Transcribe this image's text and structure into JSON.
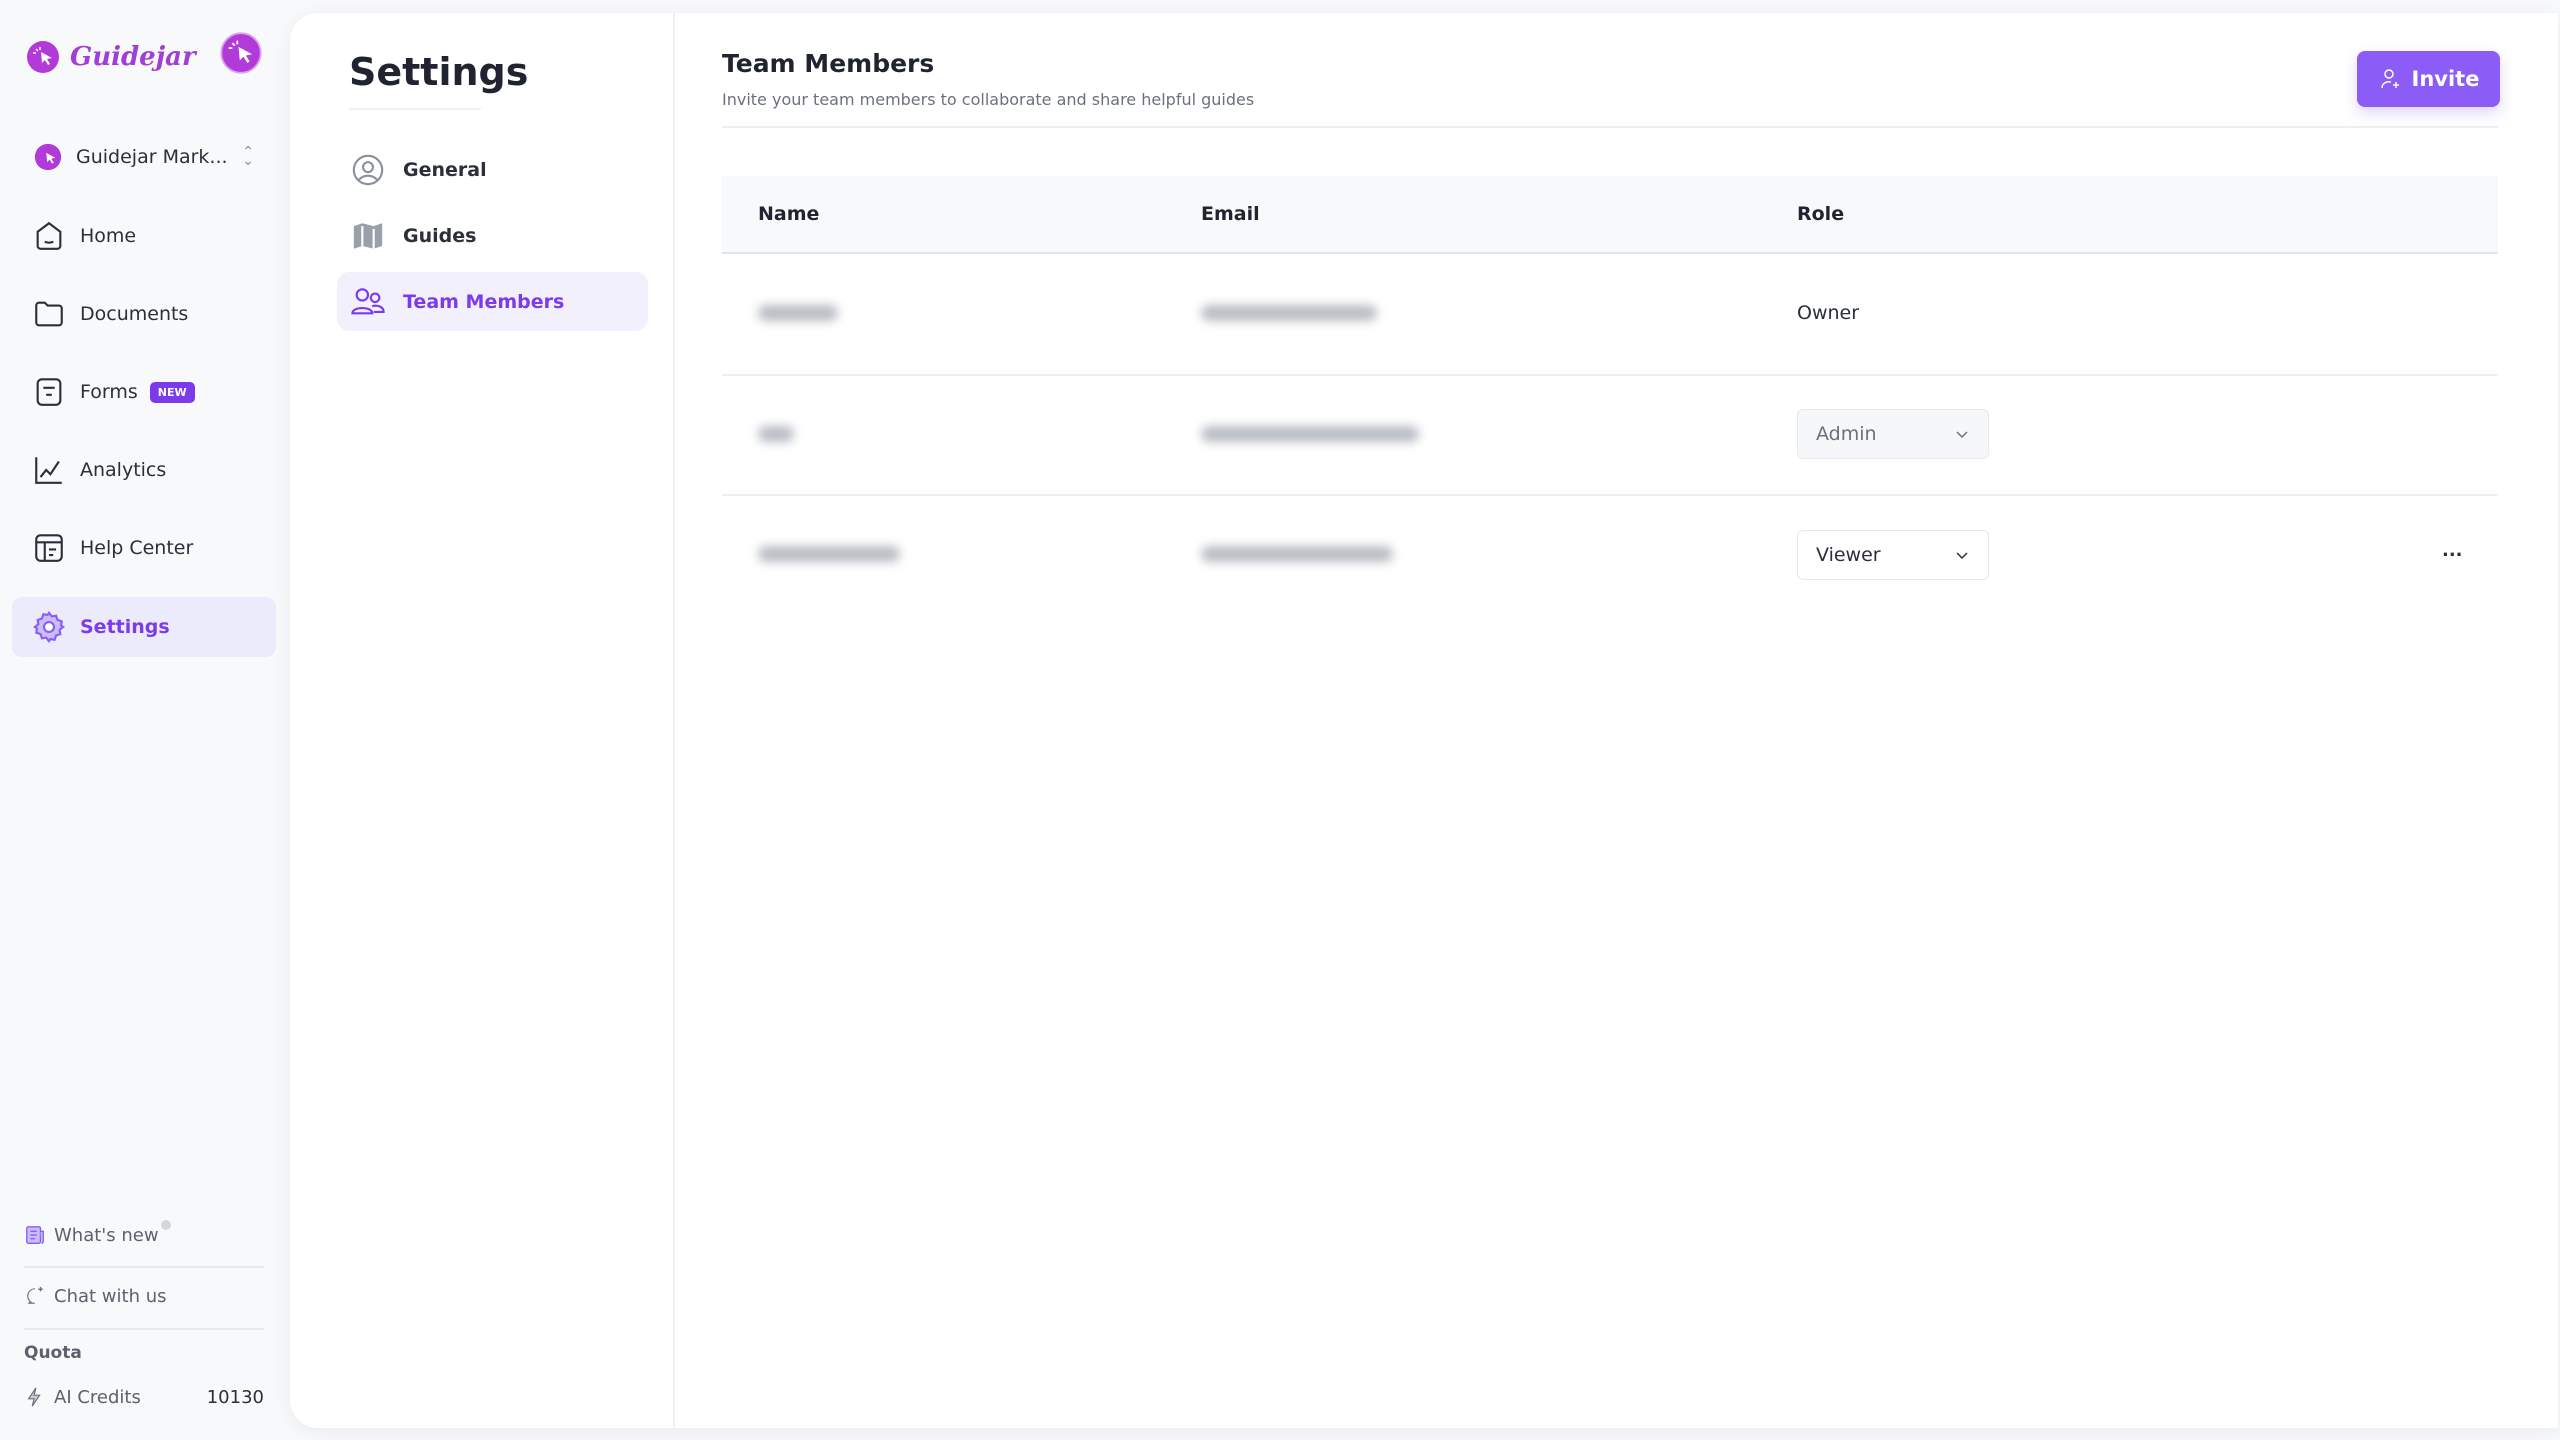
{
  "brand": {
    "name": "Guidejar",
    "accent": "#7c3aed"
  },
  "workspace": {
    "name": "Guidejar Mark..."
  },
  "sidebar": {
    "items": [
      {
        "label": "Home",
        "icon": "home-icon"
      },
      {
        "label": "Documents",
        "icon": "folder-icon"
      },
      {
        "label": "Forms",
        "icon": "form-icon",
        "badge": "NEW"
      },
      {
        "label": "Analytics",
        "icon": "chart-icon"
      },
      {
        "label": "Help Center",
        "icon": "help-center-icon"
      },
      {
        "label": "Settings",
        "icon": "gear-icon",
        "active": true
      }
    ]
  },
  "footer": {
    "whats_new": "What's new",
    "chat": "Chat with us",
    "quota_label": "Quota",
    "credits_label": "AI Credits",
    "credits_value": "10130"
  },
  "settings": {
    "title": "Settings",
    "nav": [
      {
        "label": "General",
        "icon": "user-circle-icon"
      },
      {
        "label": "Guides",
        "icon": "map-icon"
      },
      {
        "label": "Team Members",
        "icon": "users-icon",
        "active": true
      }
    ]
  },
  "team": {
    "title": "Team Members",
    "subtitle": "Invite your team members to collaborate and share helpful guides",
    "invite_label": "Invite",
    "columns": [
      "Name",
      "Email",
      "Role"
    ],
    "rows": [
      {
        "role": "Owner"
      },
      {
        "role": "Admin",
        "editable": true
      },
      {
        "role": "Viewer",
        "editable": true,
        "menu": "..."
      }
    ]
  }
}
